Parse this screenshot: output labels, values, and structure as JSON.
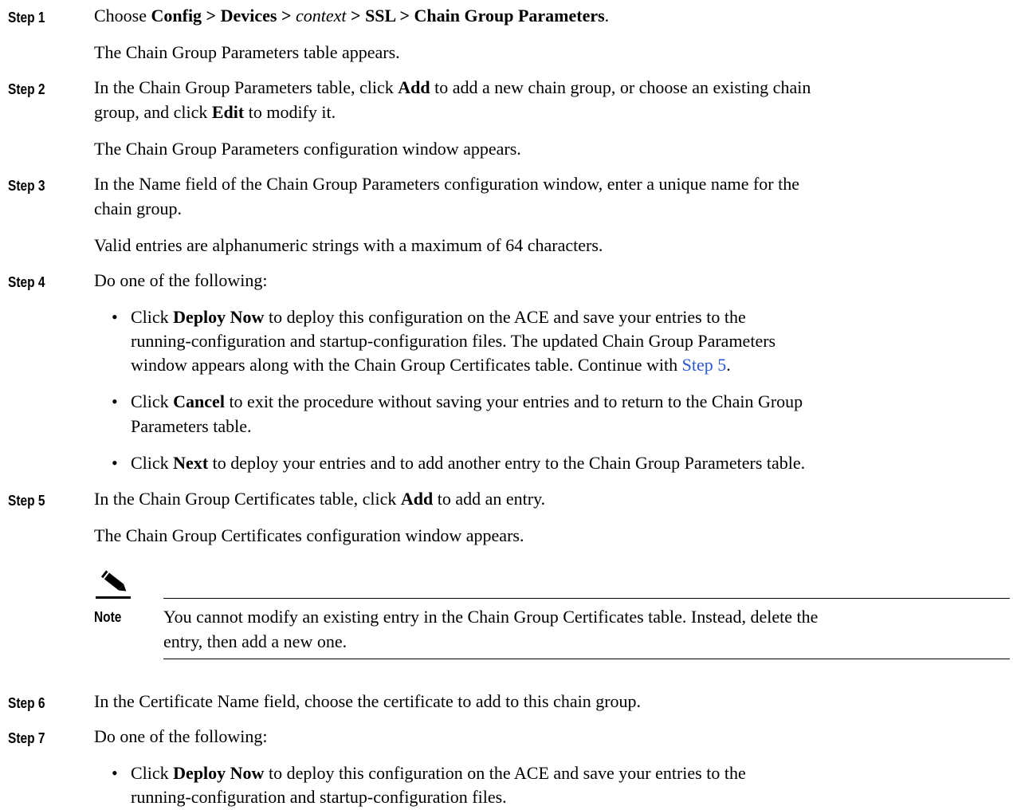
{
  "steps": [
    {
      "label": "Step 1"
    },
    {
      "label": "Step 2"
    },
    {
      "label": "Step 3"
    },
    {
      "label": "Step 4"
    },
    {
      "label": "Step 5"
    },
    {
      "label": "Step 6"
    },
    {
      "label": "Step 7"
    }
  ],
  "s1": {
    "choose": "Choose ",
    "config": "Config > Devices > ",
    "context": "context",
    "ssl": " > SSL > Chain Group Parameters",
    "period": ".",
    "result": "The Chain Group Parameters table appears."
  },
  "s2": {
    "a": "In the Chain Group Parameters table, click ",
    "add": "Add",
    "b": " to add a new chain group, or choose an existing chain",
    "c": "group, and click ",
    "edit": "Edit",
    "d": " to modify it.",
    "result": "The Chain Group Parameters configuration window appears."
  },
  "s3": {
    "line1": "In the Name field of the Chain Group Parameters configuration window, enter a unique name for the",
    "line2": "chain group.",
    "result": "Valid entries are alphanumeric strings with a maximum of 64 characters."
  },
  "s4": {
    "intro": "Do one of the following:",
    "b1_click": "Click ",
    "b1_btn": "Deploy Now",
    "b1_l1": " to deploy this configuration on the ACE and save your entries to the",
    "b1_l2": "running-configuration and startup-configuration files. The updated Chain Group Parameters",
    "b1_l3": "window appears along with the Chain Group Certificates table. Continue with ",
    "b1_link": "Step 5",
    "b1_end": ".",
    "b2_click": "Click ",
    "b2_btn": "Cancel",
    "b2_l1": " to exit the procedure without saving your entries and to return to the Chain Group",
    "b2_l2": "Parameters table.",
    "b3_click": "Click ",
    "b3_btn": "Next",
    "b3_l1": " to deploy your entries and to add another entry to the Chain Group Parameters table."
  },
  "s5": {
    "a": "In the Chain Group Certificates table, click ",
    "add": "Add",
    "b": " to add an entry.",
    "result": "The Chain Group Certificates configuration window appears."
  },
  "note": {
    "label": "Note",
    "line1": "You cannot modify an existing entry in the Chain Group Certificates table. Instead, delete the",
    "line2": "entry, then add a new one."
  },
  "s6": {
    "text": "In the Certificate Name field, choose the certificate to add to this chain group."
  },
  "s7": {
    "intro": "Do one of the following:",
    "b1_click": "Click ",
    "b1_btn": "Deploy Now",
    "b1_l1": " to deploy this configuration on the ACE and save your entries to the",
    "b1_l2": "running-configuration and startup-configuration files."
  },
  "icons": {
    "note": "pencil-icon"
  },
  "colors": {
    "link": "#2a57d6"
  }
}
